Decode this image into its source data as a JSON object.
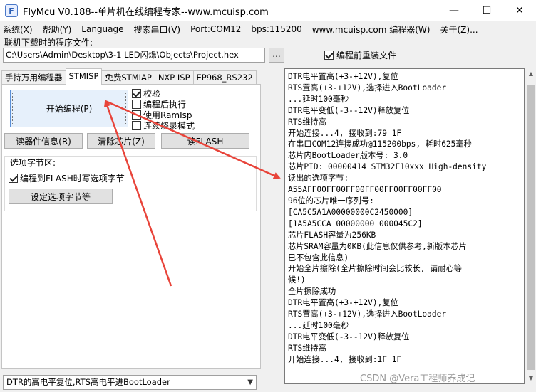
{
  "window": {
    "title": "FlyMcu V0.188--单片机在线编程专家--www.mcuisp.com",
    "app_icon_glyph": "F",
    "controls": {
      "minimize": "—",
      "maximize": "☐",
      "close": "✕"
    }
  },
  "menu": [
    "系统(X)",
    "帮助(Y)",
    "Language",
    "搜索串口(V)",
    "Port:COM12",
    "bps:115200",
    "www.mcuisp.com 编程器(W)",
    "关于(Z)..."
  ],
  "file_section": {
    "label": "联机下载时的程序文件:",
    "path": "C:\\Users\\Admin\\Desktop\\3-1 LED闪烁\\Objects\\Project.hex",
    "browse_label": "...",
    "reload_label": "编程前重装文件",
    "reload_checked": true
  },
  "tabs": [
    {
      "label": "手持万用编程器",
      "active": false
    },
    {
      "label": "STMISP",
      "active": true
    },
    {
      "label": "免费STMIAP",
      "active": false
    },
    {
      "label": "NXP ISP",
      "active": false
    },
    {
      "label": "EP968_RS232",
      "active": false
    }
  ],
  "stmisp": {
    "start_button": "开始编程(P)",
    "options": [
      {
        "label": "校验",
        "checked": true
      },
      {
        "label": "编程后执行",
        "checked": false
      },
      {
        "label": "使用RamIsp",
        "checked": false
      },
      {
        "label": "连续烧录模式",
        "checked": false
      }
    ],
    "read_info_button": "读器件信息(R)",
    "erase_button": "清除芯片(Z)",
    "read_flash_button": "读FLASH",
    "option_bytes": {
      "group_label": "选项字节区:",
      "write_checkbox_label": "编程到FLASH时写选项字节",
      "write_checked": true,
      "set_button": "设定选项字节等"
    }
  },
  "status_select": {
    "value": "DTR的高电平复位,RTS高电平进BootLoader",
    "arrow": "▼"
  },
  "log_lines": [
    "DTR电平置高(+3-+12V),复位",
    "RTS置高(+3-+12V),选择进入BootLoader",
    "...延时100毫秒",
    "DTR电平变低(-3--12V)释放复位",
    "RTS维持高",
    "开始连接...4, 接收到:79 1F",
    "在串口COM12连接成功@115200bps, 耗时625毫秒",
    "芯片内BootLoader版本号: 3.0",
    "芯片PID: 00000414  STM32F10xxx_High-density",
    "读出的选项字节:",
    "A55AFF00FF00FF00FF00FF00FF00FF00",
    "96位的芯片唯一序列号:",
    "[CA5C5A1A00000000C2450000]",
    "[1A5A5CCA 00000000 000045C2]",
    "芯片FLASH容量为256KB",
    "芯片SRAM容量为0KB(此信息仅供参考,新版本芯片",
    "已不包含此信息)",
    "开始全片擦除(全片擦除时间会比较长, 请耐心等",
    "候!)",
    "全片擦除成功",
    "DTR电平置高(+3-+12V),复位",
    "RTS置高(+3-+12V),选择进入BootLoader",
    "...延时100毫秒",
    "DTR电平变低(-3--12V)释放复位",
    "RTS维持高",
    "开始连接...4, 接收到:1F 1F"
  ],
  "scrollbar": {
    "up": "▲",
    "down": "▼"
  },
  "watermark": "CSDN @Vera工程师养成记",
  "colors": {
    "annotation_arrow": "#e8443a",
    "button_focus_border": "#5a8fd6"
  }
}
